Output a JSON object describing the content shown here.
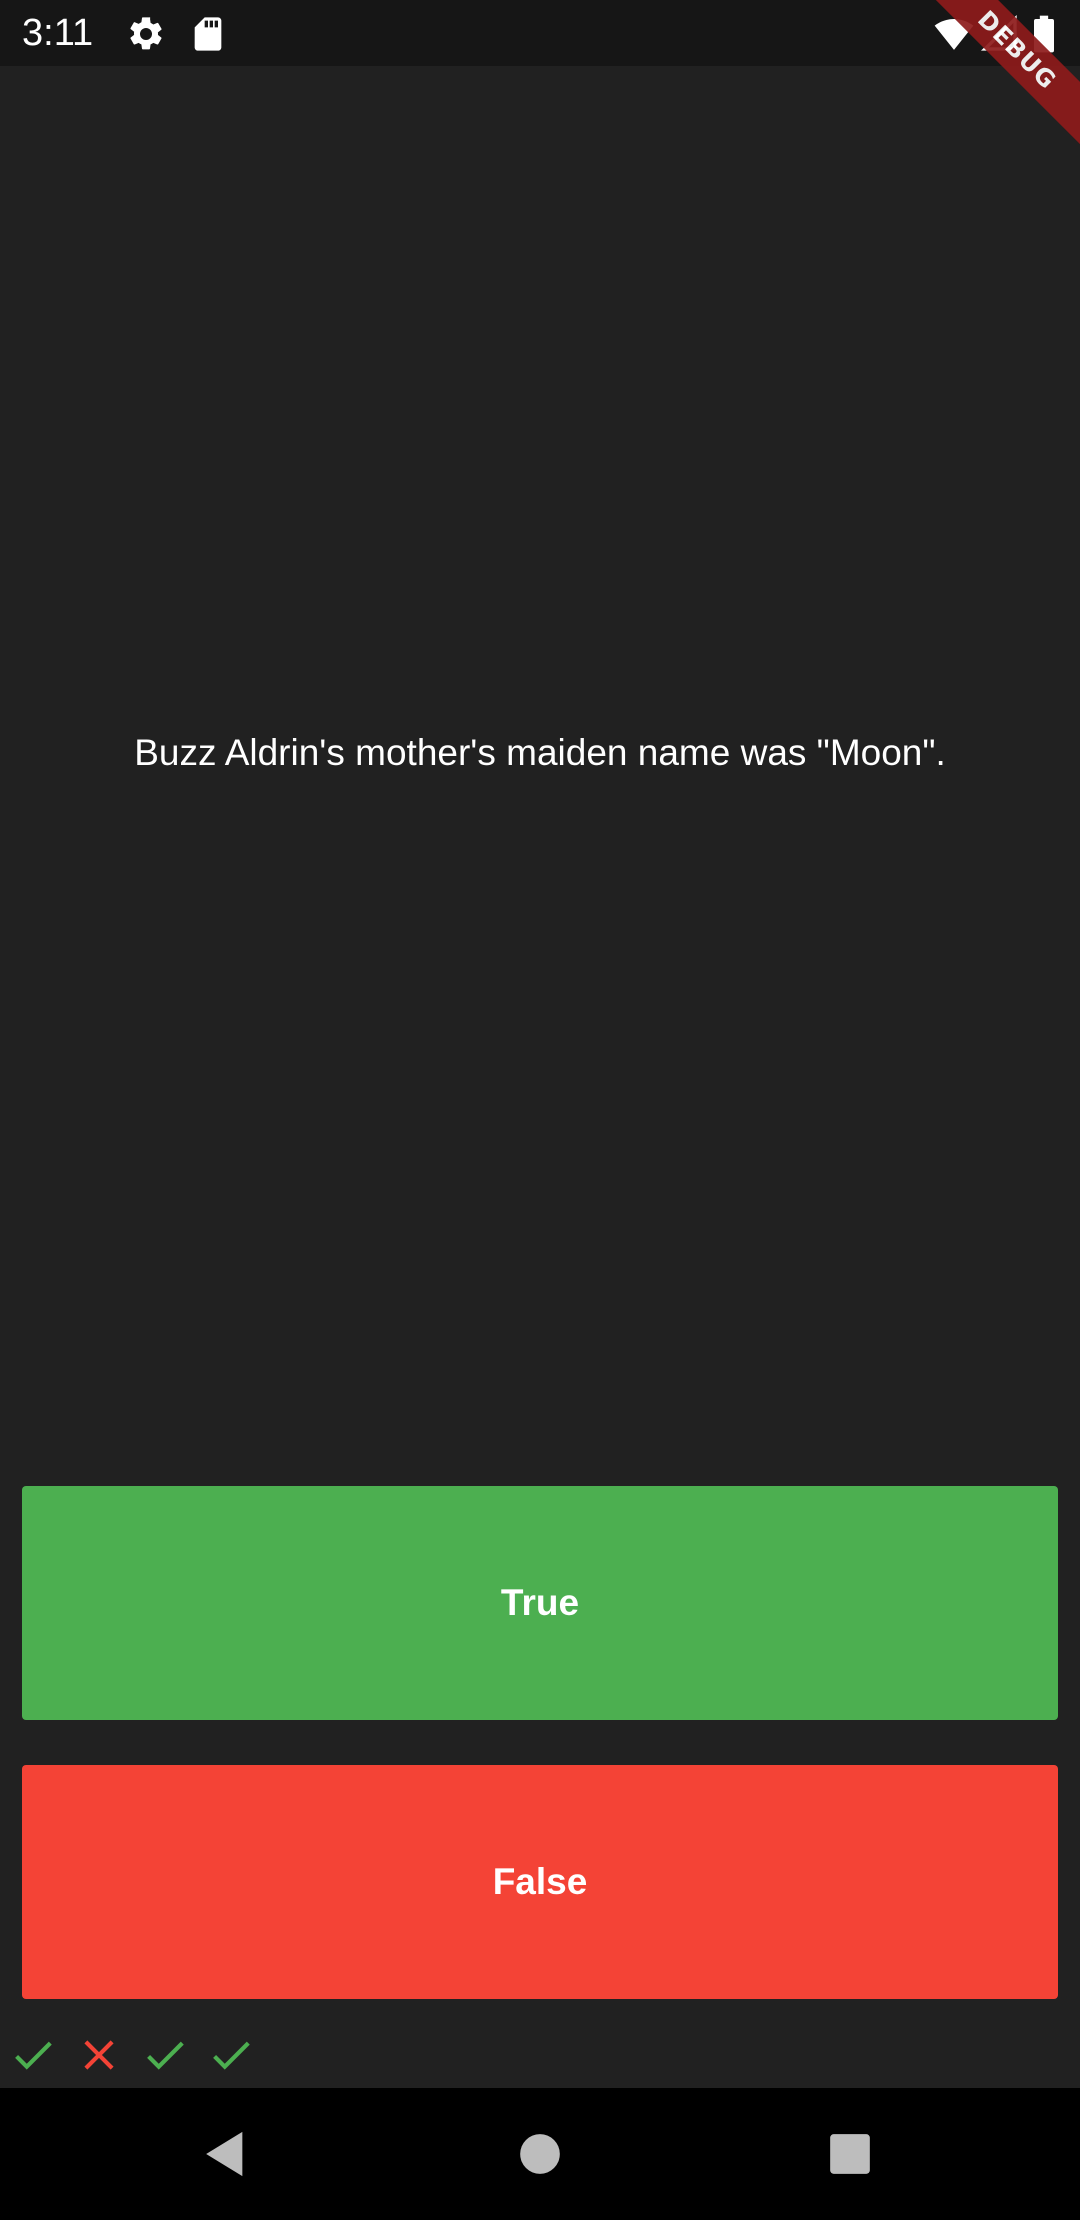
{
  "status_bar": {
    "time": "3:11",
    "icons": [
      "gear-icon",
      "sd-card-icon",
      "wifi-icon",
      "signal-icon",
      "battery-icon"
    ]
  },
  "debug_banner": {
    "label": "DEBUG"
  },
  "quiz": {
    "question": "Buzz Aldrin's mother's maiden name was \"Moon\".",
    "true_label": "True",
    "false_label": "False",
    "score_marks": [
      "check",
      "close",
      "check",
      "check"
    ]
  },
  "colors": {
    "background": "#212121",
    "true_button": "#4CAF50",
    "false_button": "#F44336",
    "check_mark": "#4CAF50",
    "cross_mark": "#F44336",
    "debug_ribbon": "#8E1B1B"
  },
  "nav_bar": {
    "buttons": [
      "back-icon",
      "home-icon",
      "recents-icon"
    ]
  }
}
